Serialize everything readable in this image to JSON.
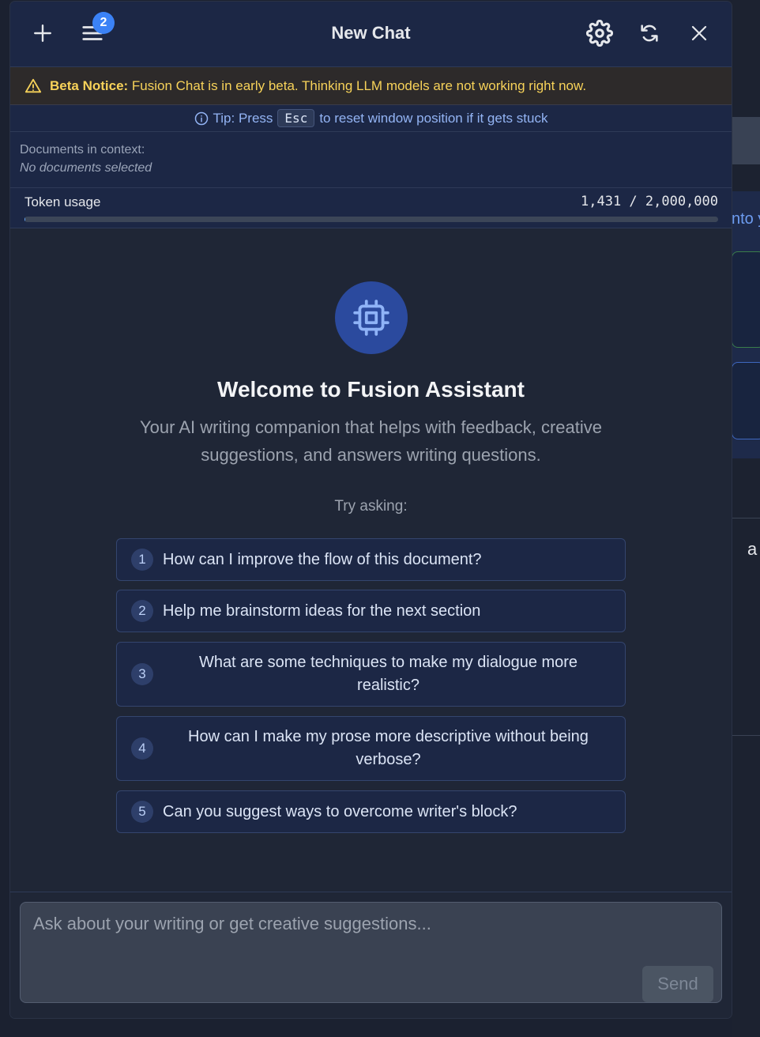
{
  "background_app": {
    "peek_text": "nto y",
    "peek_letter": "a"
  },
  "header": {
    "title": "New Chat",
    "history_badge_count": "2",
    "icons": [
      "plus-icon",
      "menu-icon",
      "gear-icon",
      "refresh-icon",
      "close-icon"
    ]
  },
  "beta_notice": {
    "label": "Beta Notice:",
    "text": " Fusion Chat is in early beta. Thinking LLM models are not working right now."
  },
  "tip": {
    "prefix": "Tip: Press",
    "key": "Esc",
    "suffix": "to reset window position if it gets stuck"
  },
  "documents": {
    "label": "Documents in context:",
    "value": "No documents selected"
  },
  "tokens": {
    "label": "Token usage",
    "value": "1,431 / 2,000,000",
    "used": 1431,
    "limit": 2000000
  },
  "welcome": {
    "title": "Welcome to Fusion Assistant",
    "subtitle": "Your AI writing companion that helps with feedback, creative suggestions, and answers writing questions.",
    "try_label": "Try asking:"
  },
  "suggestions": [
    {
      "num": "1",
      "text": "How can I improve the flow of this document?"
    },
    {
      "num": "2",
      "text": "Help me brainstorm ideas for the next section"
    },
    {
      "num": "3",
      "text": "What are some techniques to make my dialogue more realistic?"
    },
    {
      "num": "4",
      "text": "How can I make my prose more descriptive without being verbose?"
    },
    {
      "num": "5",
      "text": "Can you suggest ways to overcome writer's block?"
    }
  ],
  "composer": {
    "placeholder": "Ask about your writing or get creative suggestions...",
    "value": "",
    "send_label": "Send"
  },
  "colors": {
    "accent": "#3b82f6",
    "warning": "#f7d259",
    "header_bg": "#1c2745",
    "panel_bg": "#1f2636"
  }
}
